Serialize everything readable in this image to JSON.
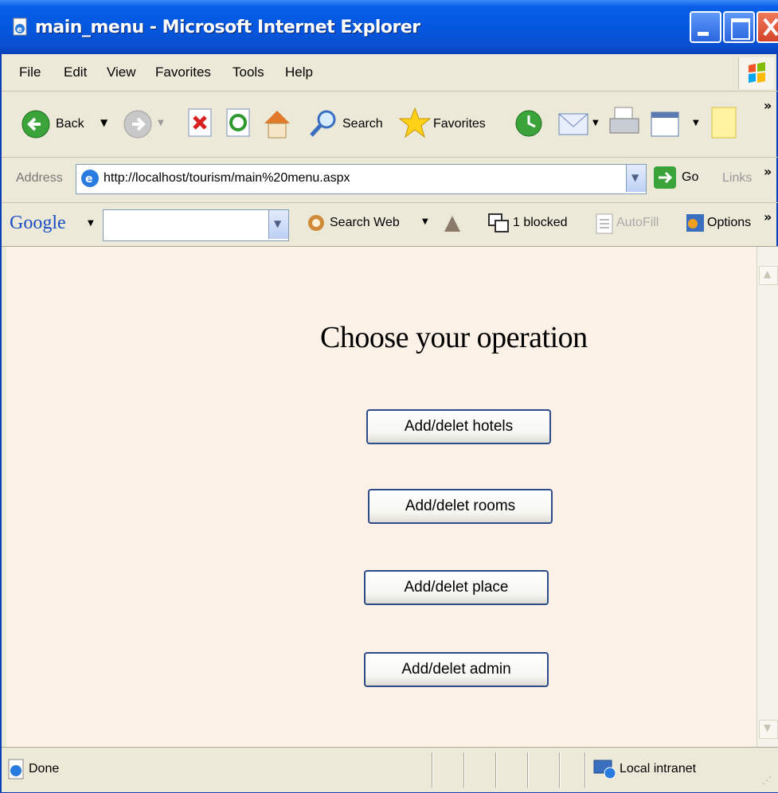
{
  "window": {
    "title": "main_menu - Microsoft Internet Explorer"
  },
  "menubar": {
    "items": [
      "File",
      "Edit",
      "View",
      "Favorites",
      "Tools",
      "Help"
    ]
  },
  "toolbar": {
    "back_label": "Back",
    "search_label": "Search",
    "favorites_label": "Favorites"
  },
  "addressbar": {
    "label": "Address",
    "url": "http://localhost/tourism/main%20menu.aspx",
    "go_label": "Go",
    "links_label": "Links"
  },
  "googlebar": {
    "logo": "Google",
    "search_web_label": "Search Web",
    "blocked_label": "1 blocked",
    "autofill_label": "AutoFill",
    "options_label": "Options"
  },
  "page": {
    "heading": "Choose your operation",
    "buttons": [
      "Add/delet hotels",
      "Add/delet rooms",
      "Add/delet place",
      "Add/delet admin"
    ]
  },
  "statusbar": {
    "status": "Done",
    "zone": "Local intranet"
  },
  "colors": {
    "title_bar": "#0458df",
    "page_background": "#fcf1e6",
    "chrome": "#ece9d8"
  }
}
